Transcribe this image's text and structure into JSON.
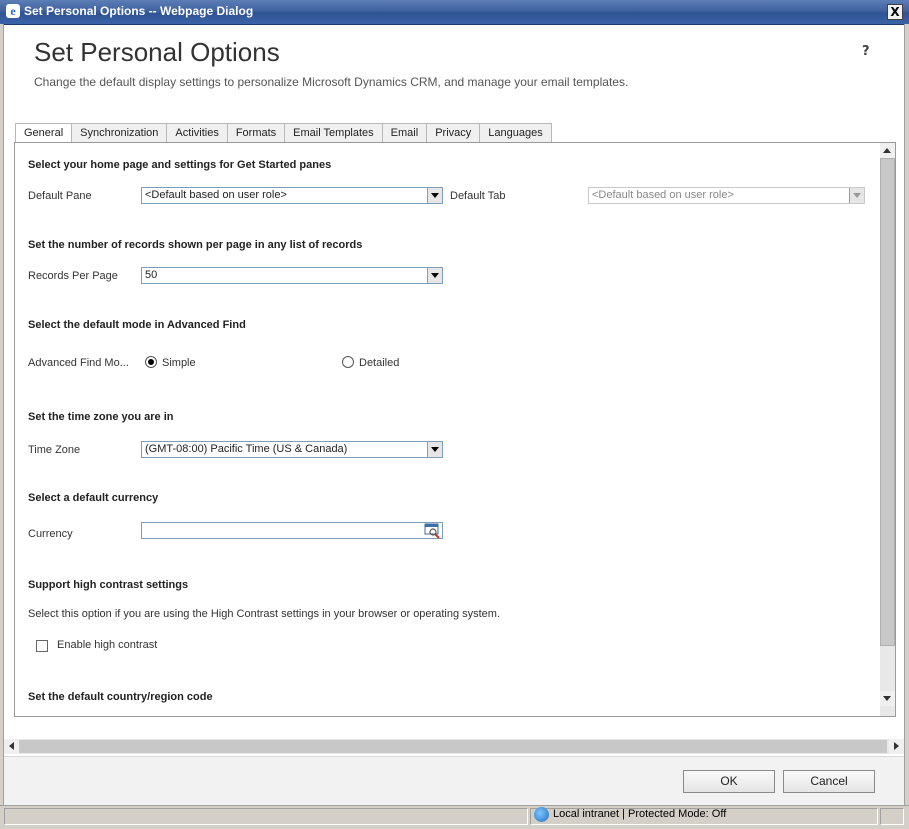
{
  "window": {
    "title": "Set Personal Options -- Webpage Dialog",
    "close_glyph": "X"
  },
  "header": {
    "title": "Set Personal Options",
    "subtitle": "Change the default display settings to personalize Microsoft Dynamics CRM, and manage your email templates.",
    "help_glyph": "?"
  },
  "tabs": [
    {
      "label": "General",
      "active": true
    },
    {
      "label": "Synchronization",
      "active": false
    },
    {
      "label": "Activities",
      "active": false
    },
    {
      "label": "Formats",
      "active": false
    },
    {
      "label": "Email Templates",
      "active": false
    },
    {
      "label": "Email",
      "active": false
    },
    {
      "label": "Privacy",
      "active": false
    },
    {
      "label": "Languages",
      "active": false
    }
  ],
  "general": {
    "home_section": {
      "title": "Select your home page and settings for Get Started panes",
      "default_pane_label": "Default Pane",
      "default_pane_value": "<Default based on user role>",
      "default_tab_label": "Default Tab",
      "default_tab_value": "<Default based on user role>"
    },
    "records_section": {
      "title": "Set the number of records shown per page in any list of records",
      "label": "Records Per Page",
      "value": "50"
    },
    "advanced_find_section": {
      "title": "Select the default mode in Advanced Find",
      "label": "Advanced Find Mo...",
      "option_simple": "Simple",
      "option_detailed": "Detailed",
      "selected": "Simple"
    },
    "timezone_section": {
      "title": "Set the time zone you are in",
      "label": "Time Zone",
      "value": "(GMT-08:00) Pacific Time (US & Canada)"
    },
    "currency_section": {
      "title": "Select a default currency",
      "label": "Currency",
      "value": ""
    },
    "contrast_section": {
      "title": "Support high contrast settings",
      "description": "Select this option if you are using the High Contrast settings in your browser or operating system.",
      "checkbox_label": "Enable high contrast",
      "checked": false
    },
    "country_section": {
      "title": "Set the default country/region code"
    }
  },
  "footer": {
    "ok_label": "OK",
    "cancel_label": "Cancel"
  },
  "statusbar": {
    "zone_text": "Local intranet | Protected Mode: Off"
  }
}
